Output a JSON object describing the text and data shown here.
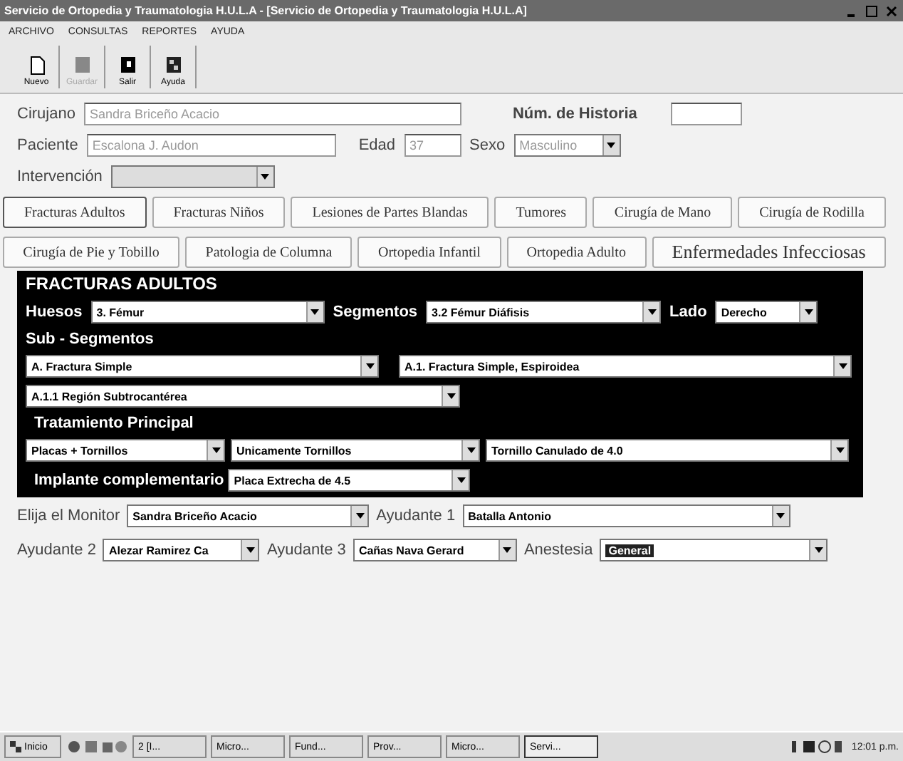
{
  "window": {
    "title": "Servicio de Ortopedia y Traumatologia H.U.L.A - [Servicio de Ortopedia y Traumatologia H.U.L.A]"
  },
  "menu": [
    "ARCHIVO",
    "CONSULTAS",
    "REPORTES",
    "AYUDA"
  ],
  "toolbar": [
    {
      "label": "Nuevo",
      "disabled": false
    },
    {
      "label": "Guardar",
      "disabled": true
    },
    {
      "label": "Salir",
      "disabled": false
    },
    {
      "label": "Ayuda",
      "disabled": false
    }
  ],
  "header": {
    "cirujano": {
      "label": "Cirujano",
      "value": "Sandra Briceño Acacio"
    },
    "historia": {
      "label": "Núm. de Historia"
    },
    "paciente": {
      "label": "Paciente",
      "value": "Escalona J. Audon"
    },
    "edad": {
      "label": "Edad",
      "value": "37"
    },
    "sexo": {
      "label": "Sexo",
      "value": "Masculino"
    },
    "intervencion": {
      "label": "Intervención"
    }
  },
  "tabs": [
    [
      {
        "label": "Fracturas Adultos",
        "selected": true
      },
      {
        "label": "Fracturas Niños",
        "selected": false
      },
      {
        "label": "Lesiones de Partes Blandas",
        "selected": false
      },
      {
        "label": "Tumores",
        "selected": false
      },
      {
        "label": "Cirugía de Mano",
        "selected": false
      },
      {
        "label": "Cirugía de Rodilla",
        "selected": false
      }
    ],
    [
      {
        "label": "Cirugía de Pie y Tobillo",
        "selected": false
      },
      {
        "label": "Patologia de Columna",
        "selected": false
      },
      {
        "label": "Ortopedia Infantil",
        "selected": false
      },
      {
        "label": "Ortopedia Adulto",
        "selected": false
      },
      {
        "label": "Enfermedades Infecciosas",
        "selected": false
      }
    ]
  ],
  "panel": {
    "title": "FRACTURAS ADULTOS",
    "huesos": {
      "label": "Huesos",
      "value": "3. Fémur"
    },
    "segmentos": {
      "label": "Segmentos",
      "value": "3.2 Fémur Diáfisis"
    },
    "lado": {
      "label": "Lado",
      "value": "Derecho"
    },
    "subsegmentos_label": "Sub - Segmentos",
    "sub": [
      "A. Fractura Simple",
      "A.1. Fractura Simple, Espiroidea",
      "A.1.1 Región Subtrocantérea"
    ],
    "tratamiento_label": "Tratamiento Principal",
    "tratamiento": [
      "Placas + Tornillos",
      "Unicamente Tornillos",
      "Tornillo Canulado de 4.0"
    ],
    "implante": {
      "label": "Implante complementario",
      "value": "Placa Extrecha de 4.5"
    }
  },
  "staff": [
    [
      {
        "label": "Elija el Monitor",
        "value": "Sandra Briceño Acacio",
        "highlighted": false
      },
      {
        "label": "Ayudante 1",
        "value": "Batalla Antonio",
        "highlighted": false
      }
    ],
    [
      {
        "label": "Ayudante 2",
        "value": "Alezar Ramirez Ca",
        "highlighted": false
      },
      {
        "label": "Ayudante 3",
        "value": "Cañas Nava Gerard",
        "highlighted": false
      },
      {
        "label": "Anestesia",
        "value": "General",
        "highlighted": true
      }
    ]
  ],
  "taskbar": {
    "start": "Inicio",
    "tasks": [
      {
        "label": "2 [I...",
        "selected": false
      },
      {
        "label": "Micro...",
        "selected": false
      },
      {
        "label": "Fund...",
        "selected": false
      },
      {
        "label": "Prov...",
        "selected": false
      },
      {
        "label": "Micro...",
        "selected": false
      },
      {
        "label": "Servi...",
        "selected": true
      }
    ],
    "clock": "12:01 p.m."
  }
}
